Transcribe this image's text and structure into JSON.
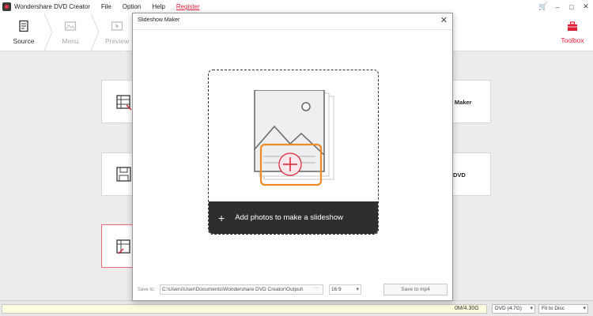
{
  "app": {
    "title": "Wondershare DVD Creator"
  },
  "menu": {
    "items": [
      "File",
      "Option",
      "Help"
    ],
    "register": "Register"
  },
  "window_controls": [
    "🛒",
    "–",
    "□",
    "✕"
  ],
  "toolbar": {
    "steps": [
      {
        "label": "Source",
        "icon": "source-icon",
        "state": "active"
      },
      {
        "label": "Menu",
        "icon": "menu-icon",
        "state": "disabled"
      },
      {
        "label": "Preview",
        "icon": "preview-icon",
        "state": "disabled"
      }
    ],
    "toolbox_label": "Toolbox"
  },
  "background_cards": {
    "slideshow_label": "w Maker",
    "dvd_label": "DVD"
  },
  "dialog": {
    "title": "Slideshow Maker",
    "close": "✕",
    "drop_zone": {
      "plus": "+",
      "text": "Add photos to make a slideshow"
    },
    "footer": {
      "save_to_label": "Save to:",
      "path": "C:\\Users\\User\\Documents\\Wondershare DVD Creator\\Output\\",
      "browse": "···",
      "aspect_ratio": "16:9",
      "save_button": "Save to mp4"
    }
  },
  "status": {
    "capacity": "0M/4.30G",
    "disc_type": "DVD (4.7G)",
    "fit_mode": "Fit to Disc"
  },
  "colors": {
    "accent": "#e0203a",
    "orange": "#f08a24",
    "dark_bar": "#2e2e2e"
  }
}
